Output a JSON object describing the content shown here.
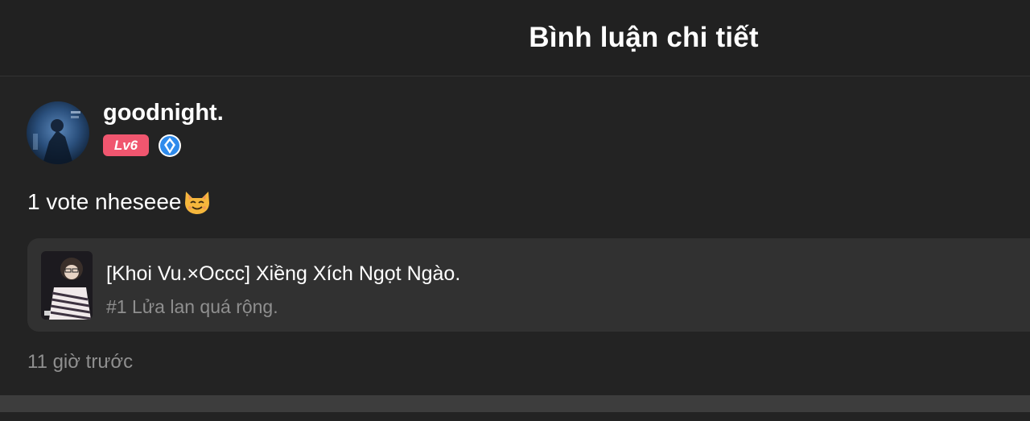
{
  "header": {
    "title": "Bình luận chi tiết"
  },
  "comment": {
    "username": "goodnight.",
    "level": "Lv6",
    "text": "1 vote nheseee",
    "emoji": "smiling-cat-emoji",
    "timestamp": "11 giờ trước"
  },
  "story": {
    "title": "[Khoi Vu.×Occc] Xiềng Xích Ngọt Ngào.",
    "chapter": "#1 Lửa lan quá rộng."
  },
  "colors": {
    "background": "#232323",
    "card": "#313131",
    "level_badge": "#f0566f",
    "rank_badge": "#2f8bec",
    "muted_text": "#8f8f8f"
  }
}
